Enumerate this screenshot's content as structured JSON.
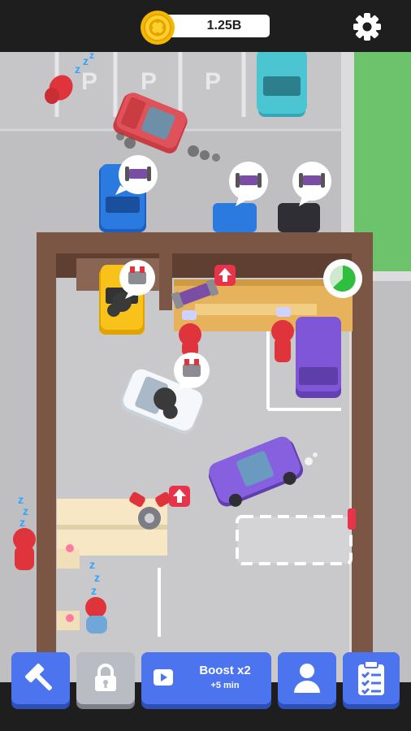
{
  "hud": {
    "coin_icon": "coin-icon",
    "coins": "1.25B",
    "settings_icon": "gear-icon"
  },
  "parking": {
    "space_labels": [
      "P",
      "P",
      "P"
    ]
  },
  "bottom_bar": {
    "build_icon": "hammer-icon",
    "locked_icon": "lock-icon",
    "boost_icon": "video-ad-icon",
    "boost_label": "Boost x2",
    "boost_sub": "+5 min",
    "staff_icon": "person-icon",
    "tasks_icon": "clipboard-checklist-icon"
  },
  "colors": {
    "top_bar": "#1e1e1e",
    "button_blue": "#4c74ee",
    "button_locked": "#b9bcc2",
    "coin_gold": "#f5b800",
    "asphalt": "#bfbfc1",
    "garage_floor": "#c9c9cb",
    "garage_wall": "#7b5644",
    "lawn": "#6cc36b",
    "upgrade_red": "#e8344b"
  }
}
